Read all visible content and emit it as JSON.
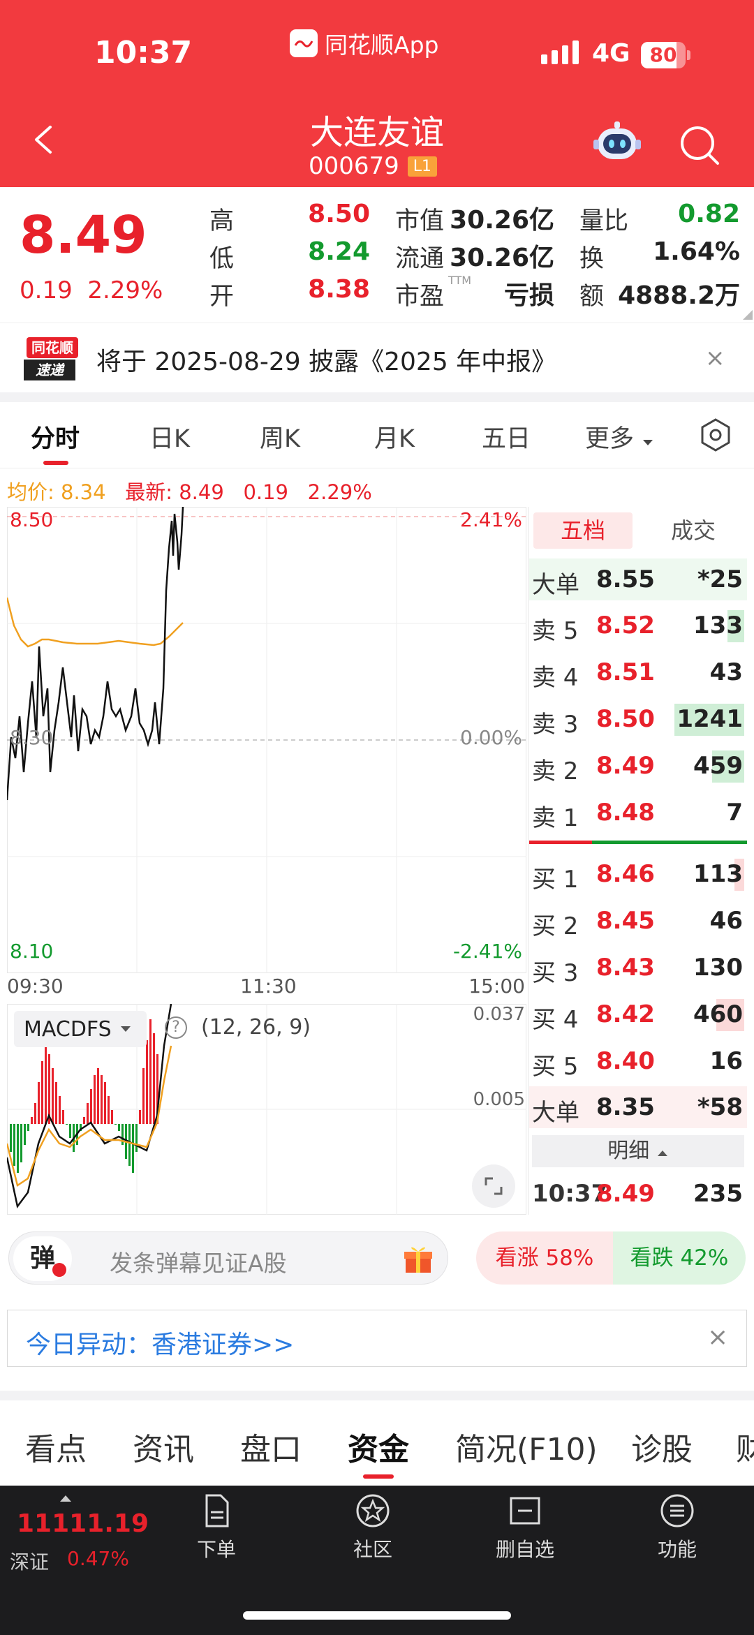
{
  "status_bar": {
    "time": "10:37",
    "app_name": "同花顺App",
    "network": "4G",
    "battery": "80",
    "battery_level": 0.8
  },
  "nav": {
    "stock_name": "大连友谊",
    "stock_code": "000679",
    "level_badge": "L1"
  },
  "quote": {
    "price": "8.49",
    "change": "0.19",
    "change_pct": "2.29%",
    "rows": [
      {
        "l1": "高",
        "v1": "8.50",
        "l2": "市值",
        "v2": "30.26亿",
        "l3": "量比",
        "v3": "0.82"
      },
      {
        "l1": "低",
        "v1": "8.24",
        "l2": "流通",
        "v2": "30.26亿",
        "l3": "换",
        "v3": "1.64%"
      },
      {
        "l1": "开",
        "v1": "8.38",
        "l2": "市盈",
        "v2": "亏损",
        "l3": "额",
        "v3": "4888.2万"
      }
    ],
    "pe_superscript": "TTM"
  },
  "notice": {
    "logo_line1": "同花顺",
    "logo_line2": "速递",
    "text": "将于 2025-08-29 披露《2025 年中报》",
    "close": "×"
  },
  "chart_tabs": [
    "分时",
    "日K",
    "周K",
    "月K",
    "五日",
    "更多"
  ],
  "intraday": {
    "avg_label": "均价: 8.34",
    "latest_label": "最新: 8.49",
    "change": "0.19",
    "change_pct": "2.29%",
    "y_top": "8.50",
    "y_mid": "8.30",
    "y_bottom": "8.10",
    "pct_top": "2.41%",
    "pct_mid": "0.00%",
    "pct_bottom": "-2.41%",
    "x_labels": [
      "09:30",
      "11:30",
      "15:00"
    ]
  },
  "macd": {
    "name": "MACDFS",
    "params": "(12, 26, 9)",
    "help": "?",
    "axis_top": "0.037",
    "axis_mid": "0.005"
  },
  "orderbook": {
    "tabs": [
      "五档",
      "成交"
    ],
    "big_sell": {
      "label": "大单",
      "price": "8.55",
      "vol": "*25"
    },
    "asks": [
      {
        "label": "卖 5",
        "price": "8.52",
        "vol": "133"
      },
      {
        "label": "卖 4",
        "price": "8.51",
        "vol": "43"
      },
      {
        "label": "卖 3",
        "price": "8.50",
        "vol": "1241"
      },
      {
        "label": "卖 2",
        "price": "8.49",
        "vol": "459"
      },
      {
        "label": "卖 1",
        "price": "8.48",
        "vol": "7"
      }
    ],
    "bids": [
      {
        "label": "买 1",
        "price": "8.46",
        "vol": "113"
      },
      {
        "label": "买 2",
        "price": "8.45",
        "vol": "46"
      },
      {
        "label": "买 3",
        "price": "8.43",
        "vol": "130"
      },
      {
        "label": "买 4",
        "price": "8.42",
        "vol": "460"
      },
      {
        "label": "买 5",
        "price": "8.40",
        "vol": "16"
      }
    ],
    "big_buy": {
      "label": "大单",
      "price": "8.35",
      "vol": "*58"
    },
    "detail_label": "明细",
    "trade": {
      "time": "10:37",
      "price": "8.49",
      "vol": "235"
    }
  },
  "danmu": {
    "badge": "弹",
    "placeholder": "发条弹幕见证A股",
    "bull": "看涨 58%",
    "bear": "看跌 42%"
  },
  "anomaly": {
    "text": "今日异动：香港证券>>",
    "close": "×"
  },
  "bottom_tabs": [
    "看点",
    "资讯",
    "盘口",
    "资金",
    "简况(F10)",
    "诊股",
    "财"
  ],
  "footer": {
    "index_value": "11111.19",
    "index_name": "深证",
    "index_change": "0.47%",
    "items": [
      "下单",
      "社区",
      "删自选",
      "功能"
    ]
  }
}
